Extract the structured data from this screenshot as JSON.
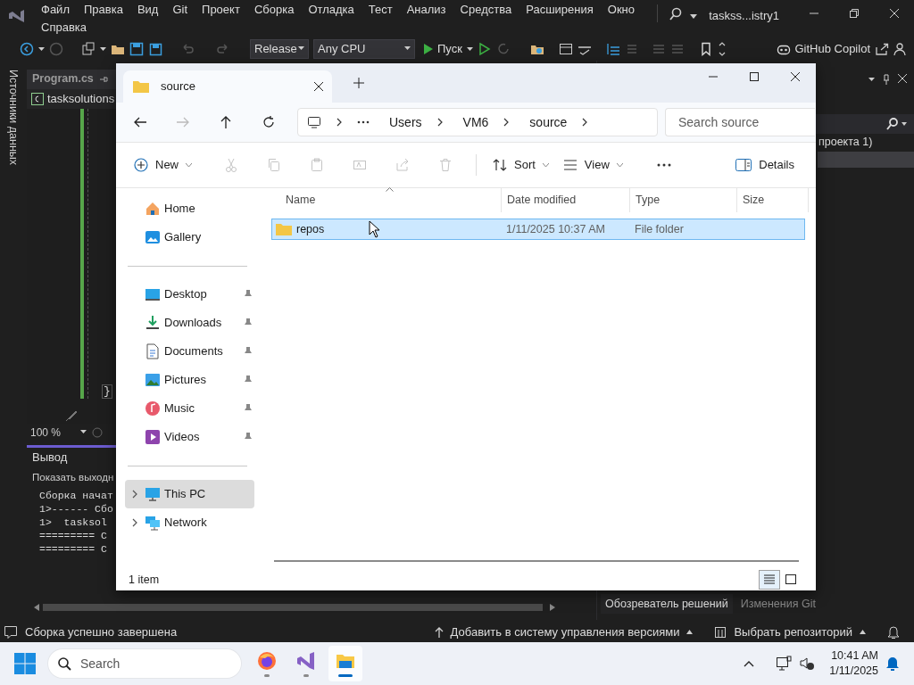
{
  "vs": {
    "menu": [
      "Файл",
      "Правка",
      "Вид",
      "Git",
      "Проект",
      "Сборка",
      "Отладка",
      "Тест",
      "Анализ",
      "Средства",
      "Расширения",
      "Окно",
      "Справка"
    ],
    "title": "taskss...istry1",
    "toolbar": {
      "configuration": "Release",
      "platform": "Any CPU",
      "run": "Пуск",
      "copilot": "GitHub Copilot"
    },
    "side_tab": "Источники данных",
    "editor": {
      "tab": "Program.cs",
      "nav": "tasksolutions",
      "brace": "}",
      "zoom": "100 %"
    },
    "output": {
      "title": "Вывод",
      "show_label": "Показать выходн",
      "lines": [
        "Сборка начат",
        "1>------ Сбо",
        "1>  tasksol",
        "========= С",
        "========= С"
      ]
    },
    "solution": {
      "row": "проекта 1)",
      "tabs": [
        {
          "label": "Обозреватель решений",
          "selected": true
        },
        {
          "label": "Изменения Git",
          "selected": false
        }
      ]
    },
    "status_bar": {
      "message": "Сборка успешно завершена",
      "source_control": "Добавить в систему управления версиями",
      "repository": "Выбрать репозиторий"
    }
  },
  "explorer": {
    "tab": "source",
    "breadcrumb": [
      "Users",
      "VM6",
      "source"
    ],
    "search": {
      "placeholder": "Search source"
    },
    "commands": [
      {
        "kind": "new",
        "label": "New",
        "disabled": false
      },
      {
        "kind": "cut",
        "disabled": true
      },
      {
        "kind": "copy",
        "disabled": true
      },
      {
        "kind": "paste",
        "disabled": true
      },
      {
        "kind": "rename",
        "disabled": true
      },
      {
        "kind": "share",
        "disabled": true
      },
      {
        "kind": "delete",
        "disabled": true
      },
      {
        "kind": "sort",
        "label": "Sort",
        "disabled": false
      },
      {
        "kind": "view",
        "label": "View",
        "disabled": false
      },
      {
        "kind": "more",
        "disabled": false
      }
    ],
    "details": "Details",
    "sidebar": [
      [
        {
          "kind": "home",
          "label": "Home",
          "selected": false
        },
        {
          "kind": "gallery",
          "label": "Gallery",
          "selected": false
        }
      ],
      [
        {
          "kind": "desktop",
          "label": "Desktop",
          "pinned": true,
          "selected": false
        },
        {
          "kind": "downloads",
          "label": "Downloads",
          "pinned": true,
          "selected": false
        },
        {
          "kind": "documents",
          "label": "Documents",
          "pinned": true,
          "selected": false
        },
        {
          "kind": "pictures",
          "label": "Pictures",
          "pinned": true,
          "selected": false
        },
        {
          "kind": "music",
          "label": "Music",
          "pinned": true,
          "selected": false
        },
        {
          "kind": "videos",
          "label": "Videos",
          "pinned": true,
          "selected": false
        }
      ],
      [
        {
          "kind": "pc",
          "label": "This PC",
          "expanded": false,
          "selected": true
        },
        {
          "kind": "network",
          "label": "Network",
          "expanded": false,
          "selected": false
        }
      ]
    ],
    "columns": [
      {
        "label": "Name",
        "sorted": true
      },
      {
        "label": "Date modified",
        "sorted": false
      },
      {
        "label": "Type",
        "sorted": false
      },
      {
        "label": "Size",
        "sorted": false
      }
    ],
    "rows": [
      {
        "name": "repos",
        "date": "1/11/2025 10:37 AM",
        "type": "File folder",
        "selected": true
      }
    ],
    "status": "1 item",
    "view_modes": [
      {
        "kind": "details",
        "selected": true
      },
      {
        "kind": "tiles",
        "selected": false
      }
    ]
  },
  "taskbar": {
    "search": {
      "placeholder": "Search"
    },
    "apps": [
      {
        "kind": "firefox",
        "selected": false
      },
      {
        "kind": "vs",
        "selected": false
      },
      {
        "kind": "explorer",
        "selected": true
      }
    ],
    "time": "10:41 AM",
    "date": "1/11/2025"
  }
}
